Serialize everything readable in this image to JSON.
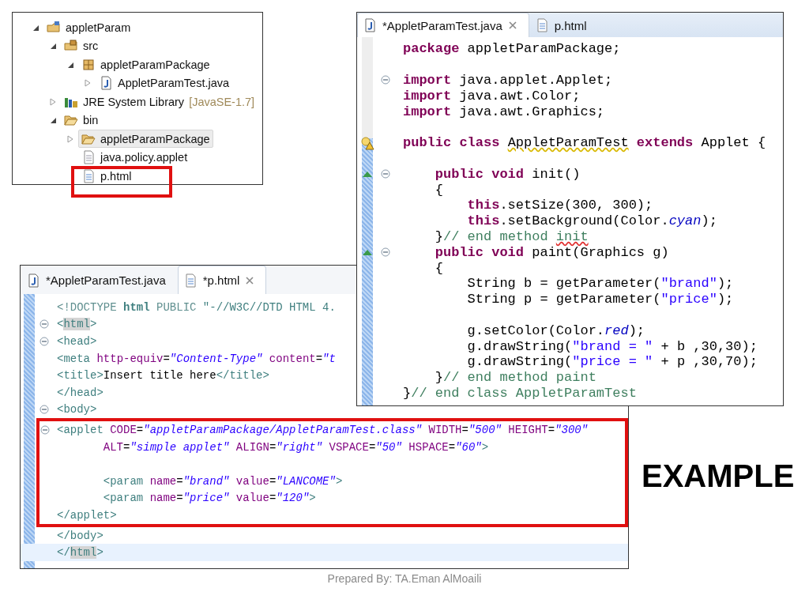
{
  "tree": {
    "items": [
      {
        "label": "appletParam",
        "kind": "project",
        "expanded": true,
        "selected": false,
        "highlighted": false,
        "children": [
          {
            "label": "src",
            "kind": "source-folder",
            "expanded": true,
            "selected": false,
            "highlighted": false,
            "children": [
              {
                "label": "appletParamPackage",
                "kind": "package",
                "expanded": true,
                "selected": false,
                "highlighted": false,
                "children": [
                  {
                    "label": "AppletParamTest.java",
                    "kind": "java-file",
                    "expanded": false,
                    "selected": false,
                    "highlighted": false
                  }
                ]
              }
            ]
          },
          {
            "label": "JRE System Library",
            "decoration": "[JavaSE-1.7]",
            "kind": "library",
            "expanded": false,
            "selected": false,
            "highlighted": false
          },
          {
            "label": "bin",
            "kind": "folder",
            "expanded": true,
            "selected": false,
            "highlighted": false,
            "children": [
              {
                "label": "appletParamPackage",
                "kind": "folder",
                "expanded": false,
                "selected": true,
                "highlighted": false
              },
              {
                "label": "java.policy.applet",
                "kind": "file",
                "selected": false,
                "highlighted": false
              },
              {
                "label": "p.html",
                "kind": "html-file",
                "selected": false,
                "highlighted": true
              }
            ]
          }
        ]
      }
    ]
  },
  "java_editor": {
    "tabs": [
      {
        "label": "*AppletParamTest.java",
        "kind": "java",
        "selected": true
      },
      {
        "label": "p.html",
        "kind": "html",
        "selected": false
      }
    ],
    "lines": [
      {
        "kind": "code",
        "tokens": [
          {
            "kind": "kw",
            "text": "package"
          },
          {
            "kind": "plain",
            "text": " appletParamPackage;"
          }
        ]
      },
      {
        "kind": "blank"
      },
      {
        "kind": "code",
        "fold": true,
        "tokens": [
          {
            "kind": "kw",
            "text": "import"
          },
          {
            "kind": "plain",
            "text": " java.applet.Applet;"
          }
        ]
      },
      {
        "kind": "code",
        "tokens": [
          {
            "kind": "kw",
            "text": "import"
          },
          {
            "kind": "plain",
            "text": " java.awt.Color;"
          }
        ]
      },
      {
        "kind": "code",
        "tokens": [
          {
            "kind": "kw",
            "text": "import"
          },
          {
            "kind": "plain",
            "text": " java.awt.Graphics;"
          }
        ]
      },
      {
        "kind": "blank"
      },
      {
        "kind": "code",
        "marker": {
          "kind": "warning"
        },
        "tokens": [
          {
            "kind": "kw",
            "text": "public class "
          },
          {
            "kind": "warn",
            "text": "AppletParamTest"
          },
          {
            "kind": "kw",
            "text": " extends"
          },
          {
            "kind": "plain",
            "text": " Applet {"
          }
        ]
      },
      {
        "kind": "blank"
      },
      {
        "kind": "code",
        "fold": true,
        "marker": {
          "kind": "override"
        },
        "tokens": [
          {
            "kind": "kw",
            "text": "    public void"
          },
          {
            "kind": "plain",
            "text": " init()"
          }
        ]
      },
      {
        "kind": "code",
        "tokens": [
          {
            "kind": "plain",
            "text": "    {"
          }
        ]
      },
      {
        "kind": "code",
        "tokens": [
          {
            "kind": "kw",
            "text": "        this"
          },
          {
            "kind": "plain",
            "text": ".setSize(300, 300);"
          }
        ]
      },
      {
        "kind": "code",
        "tokens": [
          {
            "kind": "kw",
            "text": "        this"
          },
          {
            "kind": "plain",
            "text": ".setBackground(Color."
          },
          {
            "kind": "field",
            "text": "cyan"
          },
          {
            "kind": "plain",
            "text": ");"
          }
        ]
      },
      {
        "kind": "code",
        "tokens": [
          {
            "kind": "plain",
            "text": "    }"
          },
          {
            "kind": "comment",
            "text": "// end method "
          },
          {
            "kind": "spell",
            "text": "init"
          }
        ]
      },
      {
        "kind": "code",
        "fold": true,
        "marker": {
          "kind": "override"
        },
        "tokens": [
          {
            "kind": "kw",
            "text": "    public void"
          },
          {
            "kind": "plain",
            "text": " paint(Graphics g)"
          }
        ]
      },
      {
        "kind": "code",
        "tokens": [
          {
            "kind": "plain",
            "text": "    {"
          }
        ]
      },
      {
        "kind": "code",
        "tokens": [
          {
            "kind": "plain",
            "text": "        String b = getParameter("
          },
          {
            "kind": "str",
            "text": "\"brand\""
          },
          {
            "kind": "plain",
            "text": ");"
          }
        ]
      },
      {
        "kind": "code",
        "tokens": [
          {
            "kind": "plain",
            "text": "        String p = getParameter("
          },
          {
            "kind": "str",
            "text": "\"price\""
          },
          {
            "kind": "plain",
            "text": ");"
          }
        ]
      },
      {
        "kind": "blank"
      },
      {
        "kind": "code",
        "tokens": [
          {
            "kind": "plain",
            "text": "        g.setColor(Color."
          },
          {
            "kind": "field",
            "text": "red"
          },
          {
            "kind": "plain",
            "text": ");"
          }
        ]
      },
      {
        "kind": "code",
        "tokens": [
          {
            "kind": "plain",
            "text": "        g.drawString("
          },
          {
            "kind": "str",
            "text": "\"brand = \""
          },
          {
            "kind": "plain",
            "text": " + b ,30,30);"
          }
        ]
      },
      {
        "kind": "code",
        "tokens": [
          {
            "kind": "plain",
            "text": "        g.drawString("
          },
          {
            "kind": "str",
            "text": "\"price = \""
          },
          {
            "kind": "plain",
            "text": " + p ,30,70);"
          }
        ]
      },
      {
        "kind": "code",
        "tokens": [
          {
            "kind": "plain",
            "text": "    }"
          },
          {
            "kind": "comment",
            "text": "// end method paint"
          }
        ]
      },
      {
        "kind": "code",
        "tokens": [
          {
            "kind": "plain",
            "text": "}"
          },
          {
            "kind": "comment",
            "text": "// end class AppletParamTest"
          }
        ]
      }
    ]
  },
  "html_editor": {
    "tabs": [
      {
        "label": "*AppletParamTest.java",
        "kind": "java",
        "selected": false
      },
      {
        "label": "*p.html",
        "kind": "html",
        "selected": true
      }
    ],
    "lines": [
      {
        "kind": "code",
        "highlighted": false,
        "current": false,
        "tokens": [
          {
            "kind": "doc",
            "text": "<!DOCTYPE "
          },
          {
            "kind": "docname",
            "text": "html"
          },
          {
            "kind": "doc",
            "text": " PUBLIC "
          },
          {
            "kind": "docstr",
            "text": "\"-//W3C//DTD HTML 4."
          }
        ]
      },
      {
        "kind": "code",
        "highlighted": false,
        "current": false,
        "fold": true,
        "tokens": [
          {
            "kind": "tag",
            "text": "<"
          },
          {
            "kind": "tagmark",
            "text": "html"
          },
          {
            "kind": "tag",
            "text": ">"
          }
        ]
      },
      {
        "kind": "code",
        "highlighted": false,
        "current": false,
        "fold": true,
        "tokens": [
          {
            "kind": "tag",
            "text": "<head>"
          }
        ]
      },
      {
        "kind": "code",
        "highlighted": false,
        "current": false,
        "tokens": [
          {
            "kind": "tag",
            "text": "<meta "
          },
          {
            "kind": "attr",
            "text": "http-equiv"
          },
          {
            "kind": "plain",
            "text": "="
          },
          {
            "kind": "val",
            "text": "\"Content-Type\""
          },
          {
            "kind": "attr",
            "text": " content"
          },
          {
            "kind": "plain",
            "text": "="
          },
          {
            "kind": "val",
            "text": "\"t"
          }
        ]
      },
      {
        "kind": "code",
        "highlighted": false,
        "current": false,
        "tokens": [
          {
            "kind": "tag",
            "text": "<title>"
          },
          {
            "kind": "plain",
            "text": "Insert title here"
          },
          {
            "kind": "tag",
            "text": "</title>"
          }
        ]
      },
      {
        "kind": "code",
        "highlighted": false,
        "current": false,
        "tokens": [
          {
            "kind": "tag",
            "text": "</head>"
          }
        ]
      },
      {
        "kind": "code",
        "highlighted": false,
        "current": false,
        "fold": true,
        "tokens": [
          {
            "kind": "tag",
            "text": "<body>"
          }
        ]
      },
      {
        "kind": "code",
        "highlighted": true,
        "fold": true,
        "tokens": [
          {
            "kind": "tag",
            "text": "<applet "
          },
          {
            "kind": "attr",
            "text": "CODE"
          },
          {
            "kind": "plain",
            "text": "="
          },
          {
            "kind": "val",
            "text": "\"appletParamPackage/AppletParamTest.class\""
          },
          {
            "kind": "attr",
            "text": " WIDTH"
          },
          {
            "kind": "plain",
            "text": "="
          },
          {
            "kind": "val",
            "text": "\"500\""
          },
          {
            "kind": "attr",
            "text": " HEIGHT"
          },
          {
            "kind": "plain",
            "text": "="
          },
          {
            "kind": "val",
            "text": "\"300\""
          }
        ]
      },
      {
        "kind": "code",
        "highlighted": true,
        "tokens": [
          {
            "kind": "attr",
            "text": "       ALT"
          },
          {
            "kind": "plain",
            "text": "="
          },
          {
            "kind": "val",
            "text": "\"simple applet\""
          },
          {
            "kind": "attr",
            "text": " ALIGN"
          },
          {
            "kind": "plain",
            "text": "="
          },
          {
            "kind": "val",
            "text": "\"right\""
          },
          {
            "kind": "attr",
            "text": " VSPACE"
          },
          {
            "kind": "plain",
            "text": "="
          },
          {
            "kind": "val",
            "text": "\"50\""
          },
          {
            "kind": "attr",
            "text": " HSPACE"
          },
          {
            "kind": "plain",
            "text": "="
          },
          {
            "kind": "val",
            "text": "\"60\""
          },
          {
            "kind": "tag",
            "text": ">"
          }
        ]
      },
      {
        "kind": "blank",
        "highlighted": true
      },
      {
        "kind": "code",
        "highlighted": true,
        "tokens": [
          {
            "kind": "tag",
            "text": "       <param "
          },
          {
            "kind": "attr",
            "text": "name"
          },
          {
            "kind": "plain",
            "text": "="
          },
          {
            "kind": "val",
            "text": "\"brand\""
          },
          {
            "kind": "attr",
            "text": " value"
          },
          {
            "kind": "plain",
            "text": "="
          },
          {
            "kind": "val",
            "text": "\"LANCOME\""
          },
          {
            "kind": "tag",
            "text": ">"
          }
        ]
      },
      {
        "kind": "code",
        "highlighted": true,
        "tokens": [
          {
            "kind": "tag",
            "text": "       <param "
          },
          {
            "kind": "attr",
            "text": "name"
          },
          {
            "kind": "plain",
            "text": "="
          },
          {
            "kind": "val",
            "text": "\"price\""
          },
          {
            "kind": "attr",
            "text": " value"
          },
          {
            "kind": "plain",
            "text": "="
          },
          {
            "kind": "val",
            "text": "\"120\""
          },
          {
            "kind": "tag",
            "text": ">"
          }
        ]
      },
      {
        "kind": "code",
        "highlighted": true,
        "tokens": [
          {
            "kind": "tag",
            "text": "</applet>"
          }
        ]
      },
      {
        "kind": "code",
        "highlighted": false,
        "current": false,
        "tokens": [
          {
            "kind": "tag",
            "text": "</body>"
          }
        ]
      },
      {
        "kind": "code",
        "highlighted": false,
        "current": true,
        "tokens": [
          {
            "kind": "tag",
            "text": "</"
          },
          {
            "kind": "tagmark",
            "text": "html"
          },
          {
            "kind": "tag",
            "text": ">"
          }
        ]
      }
    ]
  },
  "slide": {
    "heading": "EXAMPLE",
    "footer": "Prepared By: TA.Eman AlMoaili"
  }
}
